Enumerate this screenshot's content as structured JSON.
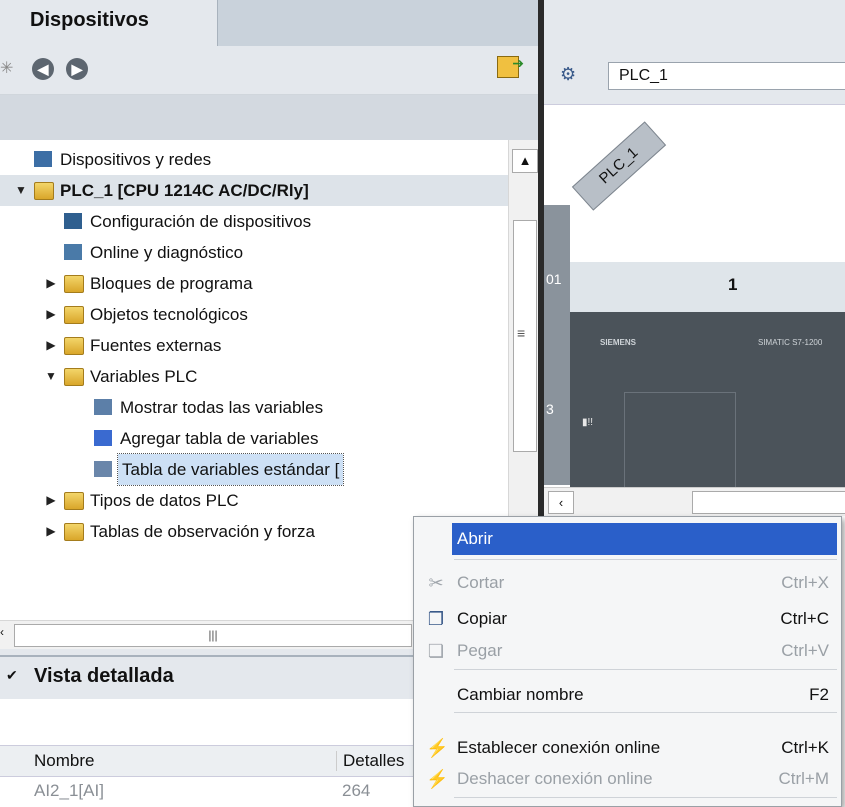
{
  "devices_pane": {
    "tab_title": "Dispositivos",
    "tree": [
      {
        "label": "Dispositivos y redes",
        "indent": 0,
        "expand": "none",
        "icon": "network-icon"
      },
      {
        "label": "PLC_1 [CPU 1214C AC/DC/Rly]",
        "indent": 0,
        "expand": "expanded",
        "icon": "plc-folder-icon",
        "bold": true
      },
      {
        "label": "Configuración de dispositivos",
        "indent": 1,
        "expand": "none",
        "icon": "device-config-icon"
      },
      {
        "label": "Online y diagnóstico",
        "indent": 1,
        "expand": "none",
        "icon": "diagnostics-icon"
      },
      {
        "label": "Bloques de programa",
        "indent": 1,
        "expand": "collapsed",
        "icon": "folder-icon"
      },
      {
        "label": "Objetos tecnológicos",
        "indent": 1,
        "expand": "collapsed",
        "icon": "folder-icon"
      },
      {
        "label": "Fuentes externas",
        "indent": 1,
        "expand": "collapsed",
        "icon": "folder-icon"
      },
      {
        "label": "Variables PLC",
        "indent": 1,
        "expand": "expanded",
        "icon": "folder-icon"
      },
      {
        "label": "Mostrar todas las variables",
        "indent": 2,
        "expand": "none",
        "icon": "tags-icon"
      },
      {
        "label": "Agregar tabla de variables",
        "indent": 2,
        "expand": "none",
        "icon": "add-table-icon"
      },
      {
        "label": "Tabla de variables estándar [",
        "indent": 2,
        "expand": "none",
        "icon": "tag-table-icon",
        "selected": true
      },
      {
        "label": "Tipos de datos PLC",
        "indent": 1,
        "expand": "collapsed",
        "icon": "folder-icon"
      },
      {
        "label": "Tablas de observación y forza",
        "indent": 1,
        "expand": "collapsed",
        "icon": "folder-icon"
      }
    ],
    "detail_view": {
      "title": "Vista detallada",
      "col_name": "Nombre",
      "col_details": "Detalles",
      "row_name": "AI2_1[AI]",
      "row_details": "264"
    }
  },
  "topology_pane": {
    "device_select": "PLC_1",
    "plc_tag": "PLC_1",
    "slot_number": "1",
    "rail_labels": [
      "01",
      "3"
    ],
    "brand": "SIEMENS",
    "model": "SIMATIC S7-1200"
  },
  "context_menu": {
    "items": [
      {
        "label": "Abrir",
        "shortcut": "",
        "enabled": true,
        "highlighted": true,
        "icon": ""
      },
      {
        "label": "Cortar",
        "shortcut": "Ctrl+X",
        "enabled": false,
        "icon": "scissors-icon"
      },
      {
        "label": "Copiar",
        "shortcut": "Ctrl+C",
        "enabled": true,
        "icon": "copy-icon"
      },
      {
        "label": "Pegar",
        "shortcut": "Ctrl+V",
        "enabled": false,
        "icon": "paste-icon"
      },
      {
        "label": "Cambiar nombre",
        "shortcut": "F2",
        "enabled": true,
        "icon": ""
      },
      {
        "label": "Establecer conexión online",
        "shortcut": "Ctrl+K",
        "enabled": true,
        "icon": "connect-online-icon"
      },
      {
        "label": "Deshacer conexión online",
        "shortcut": "Ctrl+M",
        "enabled": false,
        "icon": "disconnect-online-icon"
      }
    ]
  },
  "colors": {
    "menu_highlight": "#2a5fc9",
    "pane_bg": "#e4e8ed",
    "folder": "#e8bf45"
  }
}
